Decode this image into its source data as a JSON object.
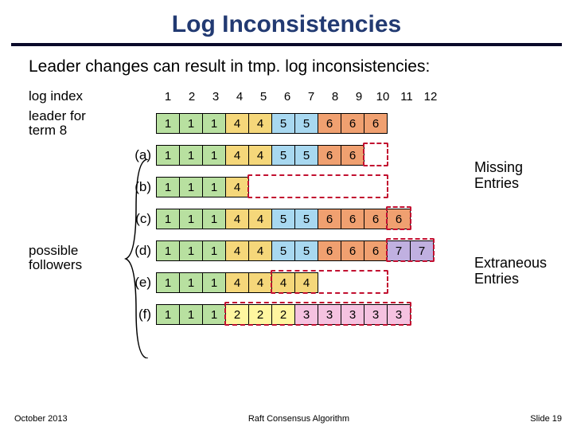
{
  "title": "Log Inconsistencies",
  "subtitle": "Leader changes can result in tmp. log inconsistencies:",
  "labels": {
    "log_index": "log index",
    "leader": "leader for\nterm 8",
    "possible": "possible\nfollowers"
  },
  "indices": [
    "1",
    "2",
    "3",
    "4",
    "5",
    "6",
    "7",
    "8",
    "9",
    "10",
    "11",
    "12"
  ],
  "leader_row": [
    {
      "v": "1",
      "t": 1
    },
    {
      "v": "1",
      "t": 1
    },
    {
      "v": "1",
      "t": 1
    },
    {
      "v": "4",
      "t": 4
    },
    {
      "v": "4",
      "t": 4
    },
    {
      "v": "5",
      "t": 5
    },
    {
      "v": "5",
      "t": 5
    },
    {
      "v": "6",
      "t": 6
    },
    {
      "v": "6",
      "t": 6
    },
    {
      "v": "6",
      "t": 6
    }
  ],
  "followers": [
    {
      "tag": "(a)",
      "cells": [
        {
          "v": "1",
          "t": 1
        },
        {
          "v": "1",
          "t": 1
        },
        {
          "v": "1",
          "t": 1
        },
        {
          "v": "4",
          "t": 4
        },
        {
          "v": "4",
          "t": 4
        },
        {
          "v": "5",
          "t": 5
        },
        {
          "v": "5",
          "t": 5
        },
        {
          "v": "6",
          "t": 6
        },
        {
          "v": "6",
          "t": 6
        }
      ],
      "dash": {
        "from": 9,
        "to": 9
      }
    },
    {
      "tag": "(b)",
      "cells": [
        {
          "v": "1",
          "t": 1
        },
        {
          "v": "1",
          "t": 1
        },
        {
          "v": "1",
          "t": 1
        },
        {
          "v": "4",
          "t": 4
        }
      ],
      "dash": {
        "from": 4,
        "to": 9
      }
    },
    {
      "tag": "(c)",
      "cells": [
        {
          "v": "1",
          "t": 1
        },
        {
          "v": "1",
          "t": 1
        },
        {
          "v": "1",
          "t": 1
        },
        {
          "v": "4",
          "t": 4
        },
        {
          "v": "4",
          "t": 4
        },
        {
          "v": "5",
          "t": 5
        },
        {
          "v": "5",
          "t": 5
        },
        {
          "v": "6",
          "t": 6
        },
        {
          "v": "6",
          "t": 6
        },
        {
          "v": "6",
          "t": 6
        },
        {
          "v": "6",
          "t": 6
        }
      ],
      "dash": {
        "from": 10,
        "to": 10
      }
    },
    {
      "tag": "(d)",
      "cells": [
        {
          "v": "1",
          "t": 1
        },
        {
          "v": "1",
          "t": 1
        },
        {
          "v": "1",
          "t": 1
        },
        {
          "v": "4",
          "t": 4
        },
        {
          "v": "4",
          "t": 4
        },
        {
          "v": "5",
          "t": 5
        },
        {
          "v": "5",
          "t": 5
        },
        {
          "v": "6",
          "t": 6
        },
        {
          "v": "6",
          "t": 6
        },
        {
          "v": "6",
          "t": 6
        },
        {
          "v": "7",
          "t": 7
        },
        {
          "v": "7",
          "t": 7
        }
      ],
      "dash": {
        "from": 10,
        "to": 11
      }
    },
    {
      "tag": "(e)",
      "cells": [
        {
          "v": "1",
          "t": 1
        },
        {
          "v": "1",
          "t": 1
        },
        {
          "v": "1",
          "t": 1
        },
        {
          "v": "4",
          "t": 4
        },
        {
          "v": "4",
          "t": 4
        },
        {
          "v": "4",
          "t": 4
        },
        {
          "v": "4",
          "t": 4
        }
      ],
      "dash": {
        "from": 5,
        "to": 9
      }
    },
    {
      "tag": "(f)",
      "cells": [
        {
          "v": "1",
          "t": 1
        },
        {
          "v": "1",
          "t": 1
        },
        {
          "v": "1",
          "t": 1
        },
        {
          "v": "2",
          "t": 2
        },
        {
          "v": "2",
          "t": 2
        },
        {
          "v": "2",
          "t": 2
        },
        {
          "v": "3",
          "t": 3
        },
        {
          "v": "3",
          "t": 3
        },
        {
          "v": "3",
          "t": 3
        },
        {
          "v": "3",
          "t": 3
        },
        {
          "v": "3",
          "t": 3
        }
      ],
      "dash": {
        "from": 3,
        "to": 10
      }
    }
  ],
  "annotations": {
    "missing": "Missing\nEntries",
    "extraneous": "Extraneous\nEntries"
  },
  "footer": {
    "left": "October 2013",
    "center": "Raft Consensus Algorithm",
    "right": "Slide 19"
  },
  "chart_data": {
    "type": "table",
    "title": "Log Inconsistencies",
    "indices": [
      1,
      2,
      3,
      4,
      5,
      6,
      7,
      8,
      9,
      10,
      11,
      12
    ],
    "leader_for_term_8": [
      1,
      1,
      1,
      4,
      4,
      5,
      5,
      6,
      6,
      6
    ],
    "possible_followers": {
      "a": [
        1,
        1,
        1,
        4,
        4,
        5,
        5,
        6,
        6
      ],
      "b": [
        1,
        1,
        1,
        4
      ],
      "c": [
        1,
        1,
        1,
        4,
        4,
        5,
        5,
        6,
        6,
        6,
        6
      ],
      "d": [
        1,
        1,
        1,
        4,
        4,
        5,
        5,
        6,
        6,
        6,
        7,
        7
      ],
      "e": [
        1,
        1,
        1,
        4,
        4,
        4,
        4
      ],
      "f": [
        1,
        1,
        1,
        2,
        2,
        2,
        3,
        3,
        3,
        3,
        3
      ]
    },
    "missing_entries_rows": [
      "a",
      "b"
    ],
    "extraneous_entries_rows": [
      "c",
      "d",
      "e",
      "f"
    ]
  }
}
